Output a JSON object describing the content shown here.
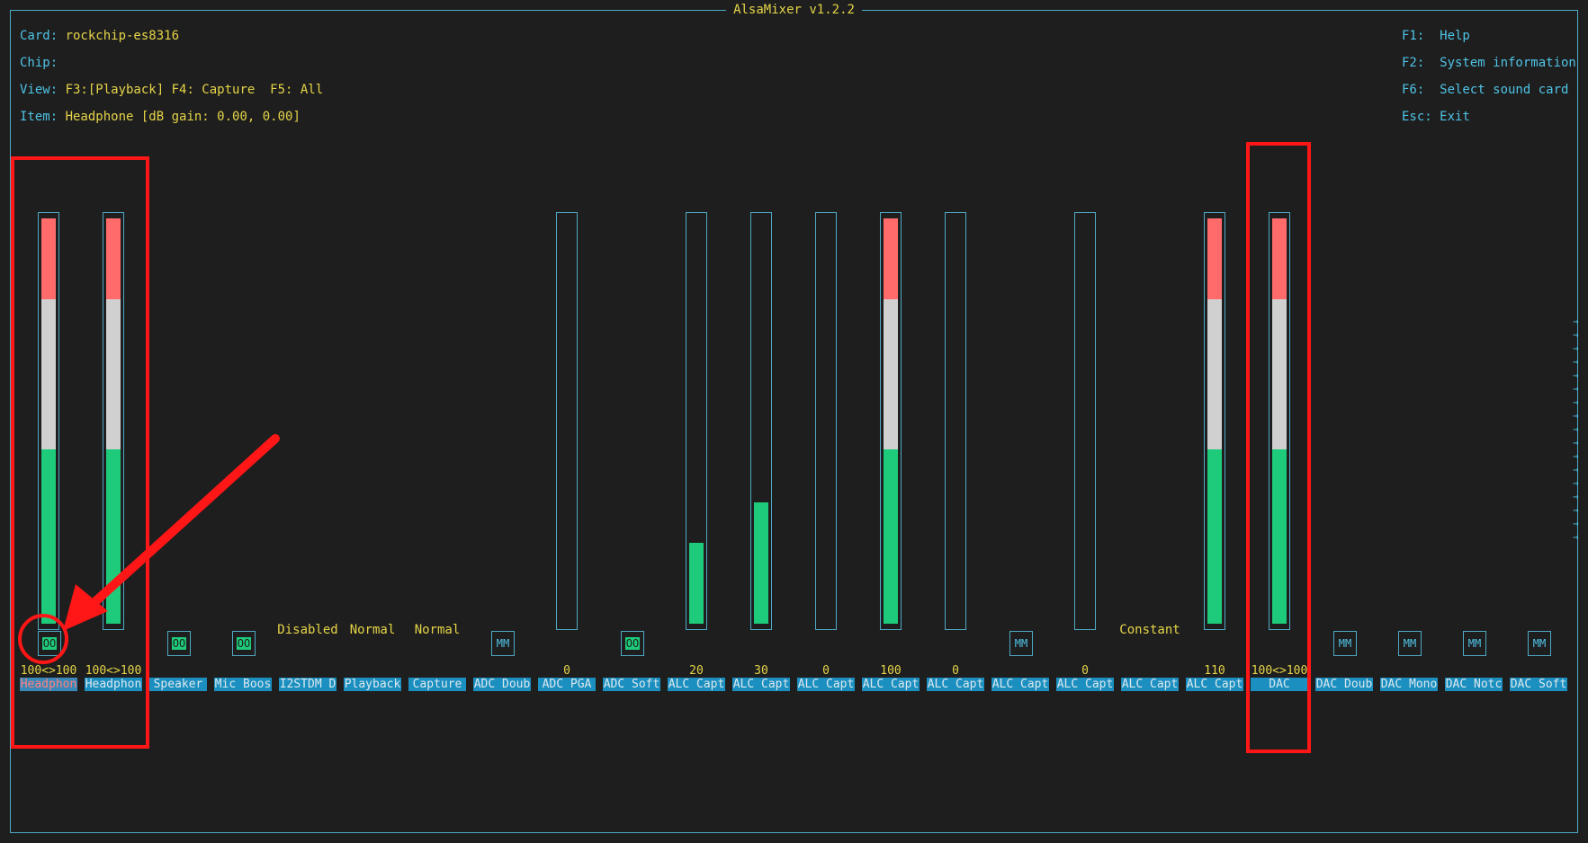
{
  "title": "AlsaMixer v1.2.2",
  "info": {
    "card_label": "Card: ",
    "card": "rockchip-es8316",
    "chip_label": "Chip:",
    "view_label": "View: ",
    "view": "F3:[Playback] F4: Capture  F5: All",
    "item_label": "Item: ",
    "item": "Headphone [dB gain: 0.00, 0.00]"
  },
  "keys": [
    "F1:  Help",
    "F2:  System information",
    "F6:  Select sound card",
    "Esc: Exit"
  ],
  "controls": [
    {
      "name": "Headphon",
      "value": "100<>100",
      "level_pct": 100,
      "switch": "OO",
      "selected": true
    },
    {
      "name": "Headphon",
      "value": "100<>100",
      "level_pct": 100,
      "switch": ""
    },
    {
      "name": "Speaker",
      "switch": "OO"
    },
    {
      "name": "Mic Boos",
      "switch": "OO"
    },
    {
      "name": "I2STDM D",
      "enum": "Disabled"
    },
    {
      "name": "Playback",
      "enum": "Normal"
    },
    {
      "name": "Capture",
      "enum": "Normal"
    },
    {
      "name": "ADC Doub",
      "switch": "MM"
    },
    {
      "name": "ADC PGA",
      "value": "0",
      "level_pct": 0
    },
    {
      "name": "ADC Soft",
      "switch": "OO"
    },
    {
      "name": "ALC Capt",
      "value": "20",
      "level_pct": 20
    },
    {
      "name": "ALC Capt",
      "value": "30",
      "level_pct": 30
    },
    {
      "name": "ALC Capt",
      "value": "0",
      "level_pct": 0
    },
    {
      "name": "ALC Capt",
      "value": "100",
      "level_pct": 100
    },
    {
      "name": "ALC Capt",
      "value": "0",
      "level_pct": 0
    },
    {
      "name": "ALC Capt",
      "switch": "MM"
    },
    {
      "name": "ALC Capt",
      "value": "0",
      "level_pct": 0
    },
    {
      "name": "ALC Capt",
      "enum": "Constant"
    },
    {
      "name": "ALC Capt",
      "value": "110",
      "level_pct": 100
    },
    {
      "name": "DAC",
      "value": "100<>100",
      "level_pct": 100
    },
    {
      "name": "DAC Doub",
      "switch": "MM"
    },
    {
      "name": "DAC Mono",
      "switch": "MM"
    },
    {
      "name": "DAC Notc",
      "switch": "MM"
    },
    {
      "name": "DAC Soft",
      "switch": "MM"
    }
  ],
  "colors": {
    "background": "#1e1e1e",
    "frame": "#4fa9c4",
    "accent_yellow": "#e5d448",
    "meter_red": "#ff6b6b",
    "meter_white": "#d0d0d0",
    "meter_green": "#1ecb7a",
    "annotation_red": "#ff1616"
  }
}
